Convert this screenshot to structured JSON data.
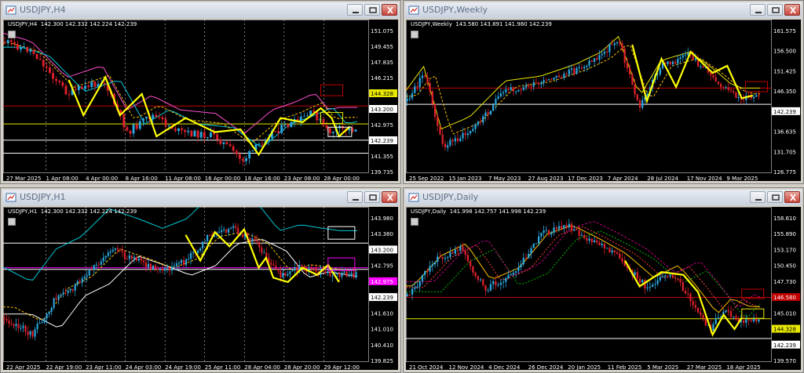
{
  "windows": [
    {
      "id": "h4",
      "title": "USDJPY,H4",
      "header": "USDJPY,H4  142.300 142.332 142.224 142.239",
      "price_labels": [
        "151.075",
        "149.455",
        "147.835",
        "146.215",
        "144.328",
        "143.200",
        "142.975",
        "142.239",
        "141.355",
        "139.735"
      ],
      "highlighted": {
        "146.580": "#c00000",
        "144.328": "#e8e800",
        "143.200": "#ffffff",
        "142.239": "#ffffff"
      },
      "time_labels": [
        "27 Mar 2025",
        "1 Apr 08:00",
        "4 Apr 00:00",
        "8 Apr 16:00",
        "11 Apr 08:00",
        "16 Apr 00:00",
        "18 Apr 16:00",
        "23 Apr 08:00",
        "28 Apr 00:00"
      ]
    },
    {
      "id": "weekly",
      "title": "USDJPY,Weekly",
      "header": "USDJPY,Weekly  143.580 143.891 141.980 142.239",
      "price_labels": [
        "161.575",
        "156.500",
        "151.425",
        "146.350",
        "142.239",
        "136.635",
        "131.705",
        "126.775"
      ],
      "highlighted": {
        "146.580": "#c00000",
        "142.239": "#ffffff"
      },
      "time_labels": [
        "25 Sep 2022",
        "15 Jan 2023",
        "7 May 2023",
        "27 Aug 2023",
        "17 Dec 2023",
        "7 Apr 2024",
        "28 Jul 2024",
        "17 Nov 2024",
        "9 Mar 2025"
      ]
    },
    {
      "id": "h1",
      "title": "USDJPY,H1",
      "header": "USDJPY,H1  142.300 142.332 142.224 142.239",
      "price_labels": [
        "143.980",
        "143.380",
        "143.200",
        "142.795",
        "142.975",
        "142.239",
        "141.610",
        "141.010",
        "140.410",
        "139.825"
      ],
      "highlighted": {
        "143.200": "#ffffff",
        "142.975": "#ff00ff",
        "142.239": "#ffffff"
      },
      "time_labels": [
        "22 Apr 2025",
        "22 Apr 19:00",
        "23 Apr 11:00",
        "24 Apr 03:00",
        "24 Apr 19:00",
        "25 Apr 11:00",
        "28 Apr 04:00",
        "28 Apr 20:00",
        "29 Apr 12:00"
      ]
    },
    {
      "id": "daily",
      "title": "USDJPY,Daily",
      "header": "USDJPY,Daily  141.998 142.757 141.998 142.239",
      "price_labels": [
        "158.610",
        "155.890",
        "153.170",
        "150.450",
        "147.730",
        "146.580",
        "145.010",
        "144.328",
        "142.239",
        "139.570"
      ],
      "highlighted": {
        "146.580": "#c00000",
        "144.328": "#e8e800",
        "142.239": "#ffffff"
      },
      "time_labels": [
        "21 Oct 2024",
        "12 Nov 2024",
        "4 Dec 2024",
        "26 Dec 2024",
        "20 Jan 2025",
        "11 Feb 2025",
        "5 Mar 2025",
        "27 Mar 2025",
        "18 Apr 2025"
      ]
    }
  ],
  "icons": {
    "minimize": "minimize-icon",
    "restore": "restore-icon",
    "close": "close-icon",
    "window": "chart-window-icon"
  }
}
